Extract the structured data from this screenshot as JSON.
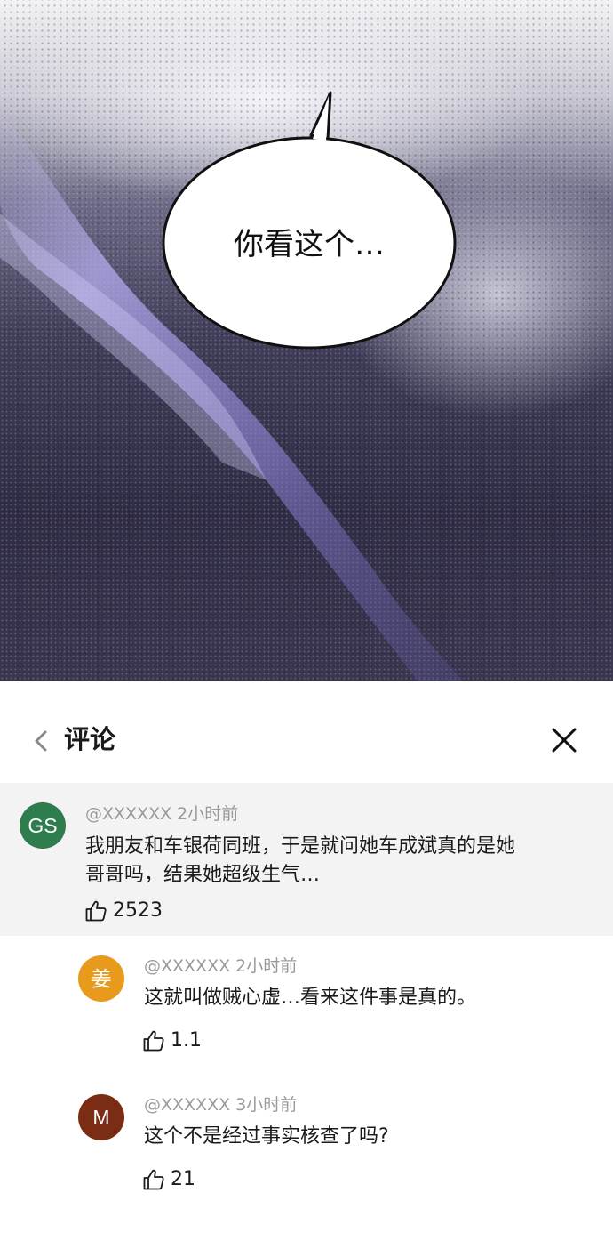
{
  "art": {
    "speech_bubble_text": "你看这个…"
  },
  "panel": {
    "title": "评论",
    "back_icon": "chevron-left-icon",
    "close_icon": "close-icon"
  },
  "comments": [
    {
      "avatar_text": "GS",
      "avatar_color": "#2e7d4f",
      "user": "@XXXXXX",
      "time": "2小时前",
      "text_line1": "我朋友和车银荷同班，于是就问她车成斌真的是她",
      "text_line2": "哥哥吗，结果她超级生气…",
      "likes": "2523"
    }
  ],
  "replies": [
    {
      "avatar_text": "姜",
      "avatar_color": "#e89a1c",
      "user": "@XXXXXX",
      "time": "2小时前",
      "text": "这就叫做贼心虚…看来这件事是真的。",
      "likes": "1.1"
    },
    {
      "avatar_text": "M",
      "avatar_color": "#7a2d14",
      "user": "@XXXXXX",
      "time": "3小时前",
      "text": "这个不是经过事实核查了吗?",
      "likes": "21"
    }
  ]
}
